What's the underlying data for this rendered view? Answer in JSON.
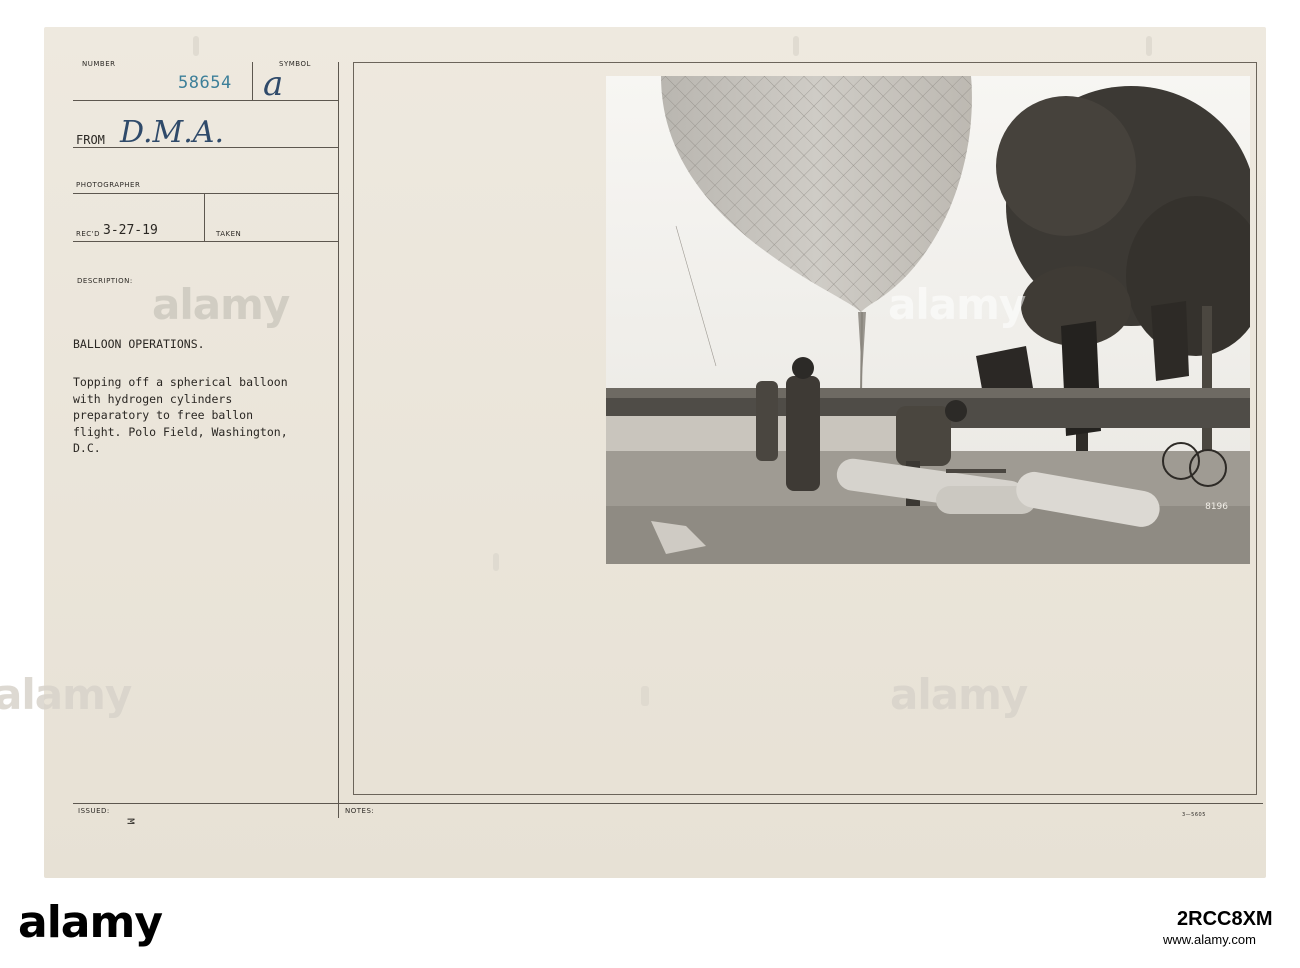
{
  "record": {
    "number_label": "NUMBER",
    "number_value": "58654",
    "symbol_label": "SYMBOL",
    "symbol_value": "a",
    "from_label": "FROM",
    "from_value": "D.M.A.",
    "photographer_label": "PHOTOGRAPHER",
    "recd_label": "REC'D",
    "recd_value": "3-27-19",
    "taken_label": "TAKEN",
    "description_label": "DESCRIPTION:",
    "title": "BALLOON OPERATIONS.",
    "description_lines": [
      "Topping off a spherical balloon",
      "with hydrogen cylinders",
      "preparatory to free ballon",
      "flight.  Polo Field, Washington,",
      "D.C."
    ],
    "issued_label": "ISSUED:",
    "issued_mark": "M",
    "notes_label": "NOTES:",
    "form_number": "3—5605",
    "photo_number": "8196"
  },
  "watermarks": {
    "text": "alamy"
  },
  "stock_bar": {
    "logo": "alamy",
    "image_id": "2RCC8XM",
    "url": "www.alamy.com"
  }
}
